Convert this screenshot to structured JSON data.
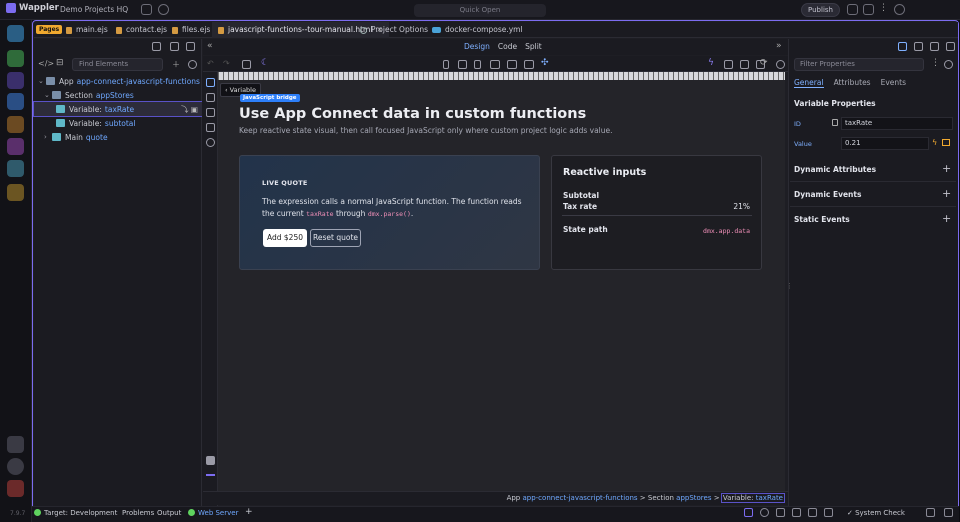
{
  "app": {
    "name": "Wappler",
    "project": "Demo Projects HQ",
    "version": "7.9.7"
  },
  "search": {
    "placeholder": "Quick Open"
  },
  "publish_label": "Publish",
  "pages_badge": "Pages",
  "tabs": [
    {
      "label": "main.ejs"
    },
    {
      "label": "contact.ejs"
    },
    {
      "label": "files.ejs"
    },
    {
      "label": "javascript-functions--tour-manual.html",
      "active": true
    },
    {
      "label": "Project Options"
    },
    {
      "label": "docker-compose.yml"
    }
  ],
  "left_panel": {
    "find_placeholder": "Find Elements",
    "tree": [
      {
        "key": "App",
        "value": "app-connect-javascript-functions"
      },
      {
        "key": "Section",
        "value": "appStores"
      },
      {
        "key": "Variable:",
        "value": "taxRate",
        "selected": true
      },
      {
        "key": "Variable:",
        "value": "subtotal"
      },
      {
        "key": "Main",
        "value": "quote"
      }
    ]
  },
  "view_modes": {
    "design": "Design",
    "code": "Code",
    "split": "Split"
  },
  "tooltip": "Variable",
  "page": {
    "badge": "JavaScript bridge",
    "heading": "Use App Connect data in custom functions",
    "lead": "Keep reactive state visual, then call focused JavaScript only where custom project logic adds value.",
    "live_quote": {
      "title": "LIVE QUOTE",
      "text_before": "The expression calls a normal JavaScript function. The function reads the current",
      "code1": "taxRate",
      "text_mid": "through",
      "code2": "dmx.parse()",
      "text_end": ".",
      "add_button": "Add $250",
      "reset_button": "Reset quote"
    },
    "reactive": {
      "title": "Reactive inputs",
      "subtotal_label": "Subtotal",
      "subtotal_value": "",
      "tax_label": "Tax rate",
      "tax_value": "21%",
      "state_label": "State path",
      "state_value": "dmx.app.data"
    }
  },
  "breadcrumb": {
    "app_label": "App",
    "app_value": "app-connect-javascript-functions",
    "sep": ">",
    "section_label": "Section",
    "section_value": "appStores",
    "var_label": "Variable:",
    "var_value": "taxRate"
  },
  "right_panel": {
    "filter_placeholder": "Filter Properties",
    "tabs": [
      "General",
      "Attributes",
      "Events"
    ],
    "section_title": "Variable Properties",
    "id_label": "ID",
    "id_value": "taxRate",
    "value_label": "Value",
    "value_value": "0.21",
    "groups": [
      "Dynamic Attributes",
      "Dynamic Events",
      "Static Events"
    ]
  },
  "statusbar": {
    "target": "Target: Development",
    "problems": "Problems",
    "output": "Output",
    "webserver": "Web Server",
    "system_check": "System Check"
  },
  "colors": {
    "accent": "#7c6cf0",
    "link": "#6fa8ff",
    "green": "#5fd35f",
    "orange": "#f0a92f"
  }
}
